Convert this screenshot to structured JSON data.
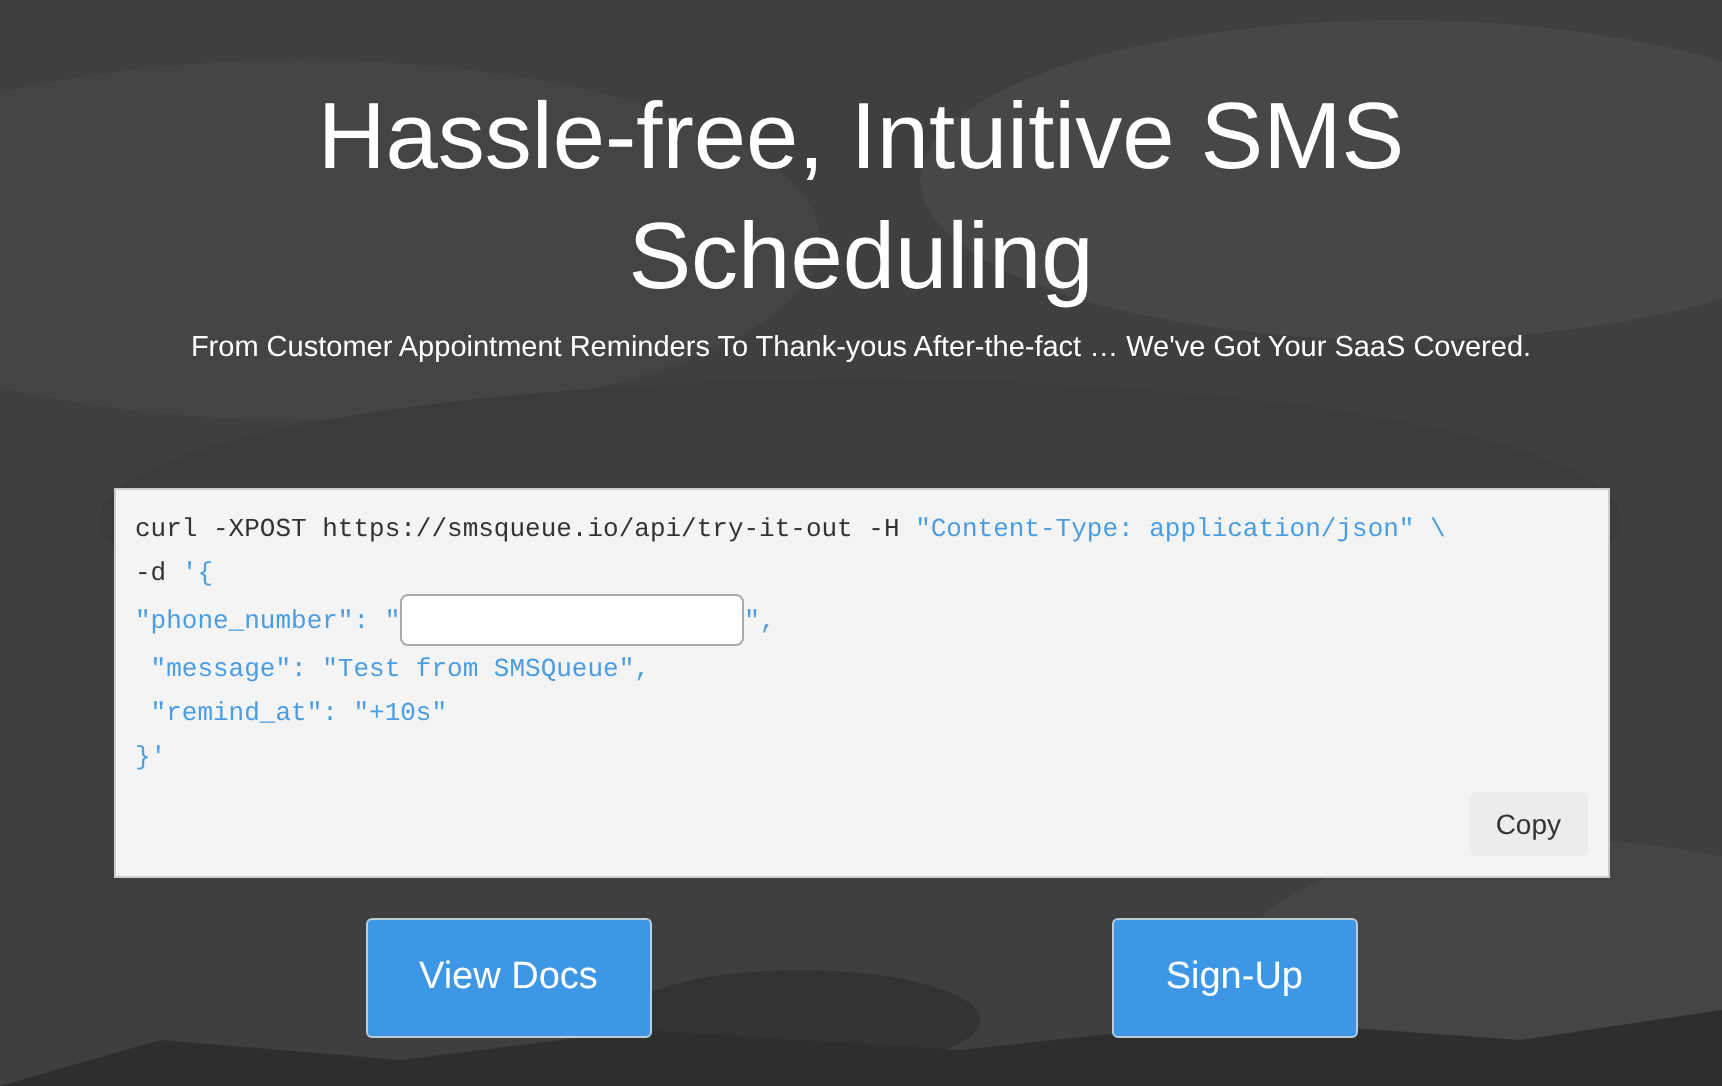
{
  "hero": {
    "title": "Hassle-free, Intuitive SMS Scheduling",
    "subtitle": "From Customer Appointment Reminders To Thank-yous After-the-fact … We've Got Your SaaS Covered."
  },
  "code": {
    "lines": [
      [
        {
          "kind": "plain",
          "text": "curl -XPOST https://smsqueue.io/api/try-it-out -H "
        },
        {
          "kind": "string",
          "text": "\"Content-Type: application/json\" \\"
        }
      ],
      [
        {
          "kind": "plain",
          "text": "-d "
        },
        {
          "kind": "string",
          "text": "'{"
        }
      ],
      [
        {
          "kind": "string",
          "text": "\"phone_number\": \""
        },
        {
          "kind": "input"
        },
        {
          "kind": "string",
          "text": "\","
        }
      ],
      [
        {
          "kind": "string",
          "text": " \"message\": \"Test from SMSQueue\","
        }
      ],
      [
        {
          "kind": "string",
          "text": " \"remind_at\": \"+10s\""
        }
      ],
      [
        {
          "kind": "string",
          "text": "}'"
        }
      ]
    ],
    "copy_button": "Copy"
  },
  "buttons": [
    "View Docs",
    "Sign-Up"
  ]
}
